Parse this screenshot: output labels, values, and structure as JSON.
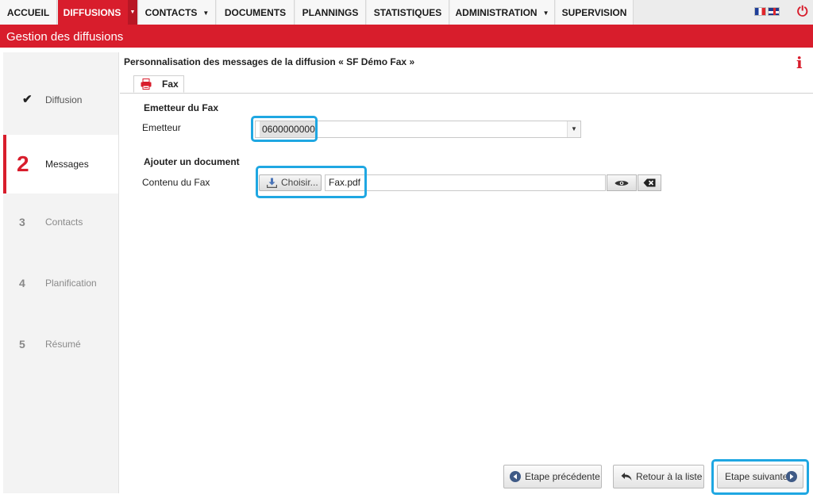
{
  "nav": {
    "items": [
      "ACCUEIL",
      "DIFFUSIONS",
      "CONTACTS",
      "DOCUMENTS",
      "PLANNINGS",
      "STATISTIQUES",
      "ADMINISTRATION",
      "SUPERVISION"
    ],
    "active": "DIFFUSIONS"
  },
  "colors": {
    "brand_red": "#d81d2c",
    "highlight_blue": "#1fa7e2",
    "nav_icon_blue": "#3f5a86"
  },
  "page_title": "Gestion des diffusions",
  "steps": [
    {
      "num": "✔",
      "label": "Diffusion",
      "state": "done"
    },
    {
      "num": "2",
      "label": "Messages",
      "state": "active"
    },
    {
      "num": "3",
      "label": "Contacts",
      "state": "pending"
    },
    {
      "num": "4",
      "label": "Planification",
      "state": "pending"
    },
    {
      "num": "5",
      "label": "Résumé",
      "state": "pending"
    }
  ],
  "main": {
    "title": "Personnalisation des messages de la diffusion « SF Démo Fax »",
    "info_icon": "i",
    "tab_label": "Fax",
    "sender_section": "Emetteur du Fax",
    "sender_label": "Emetteur",
    "sender_value": "0600000000",
    "document_section": "Ajouter un document",
    "content_label": "Contenu du Fax",
    "choose_label": "Choisir...",
    "file_name": "Fax.pdf"
  },
  "buttons": {
    "previous": "Etape précédente",
    "back_to_list": "Retour à la liste",
    "next": "Etape suivante"
  },
  "icons": [
    "check-icon",
    "fax-icon",
    "download-icon",
    "eye-icon",
    "delete-icon",
    "power-icon",
    "info-icon",
    "arrow-left-icon",
    "arrow-right-icon",
    "back-arrow-icon"
  ]
}
